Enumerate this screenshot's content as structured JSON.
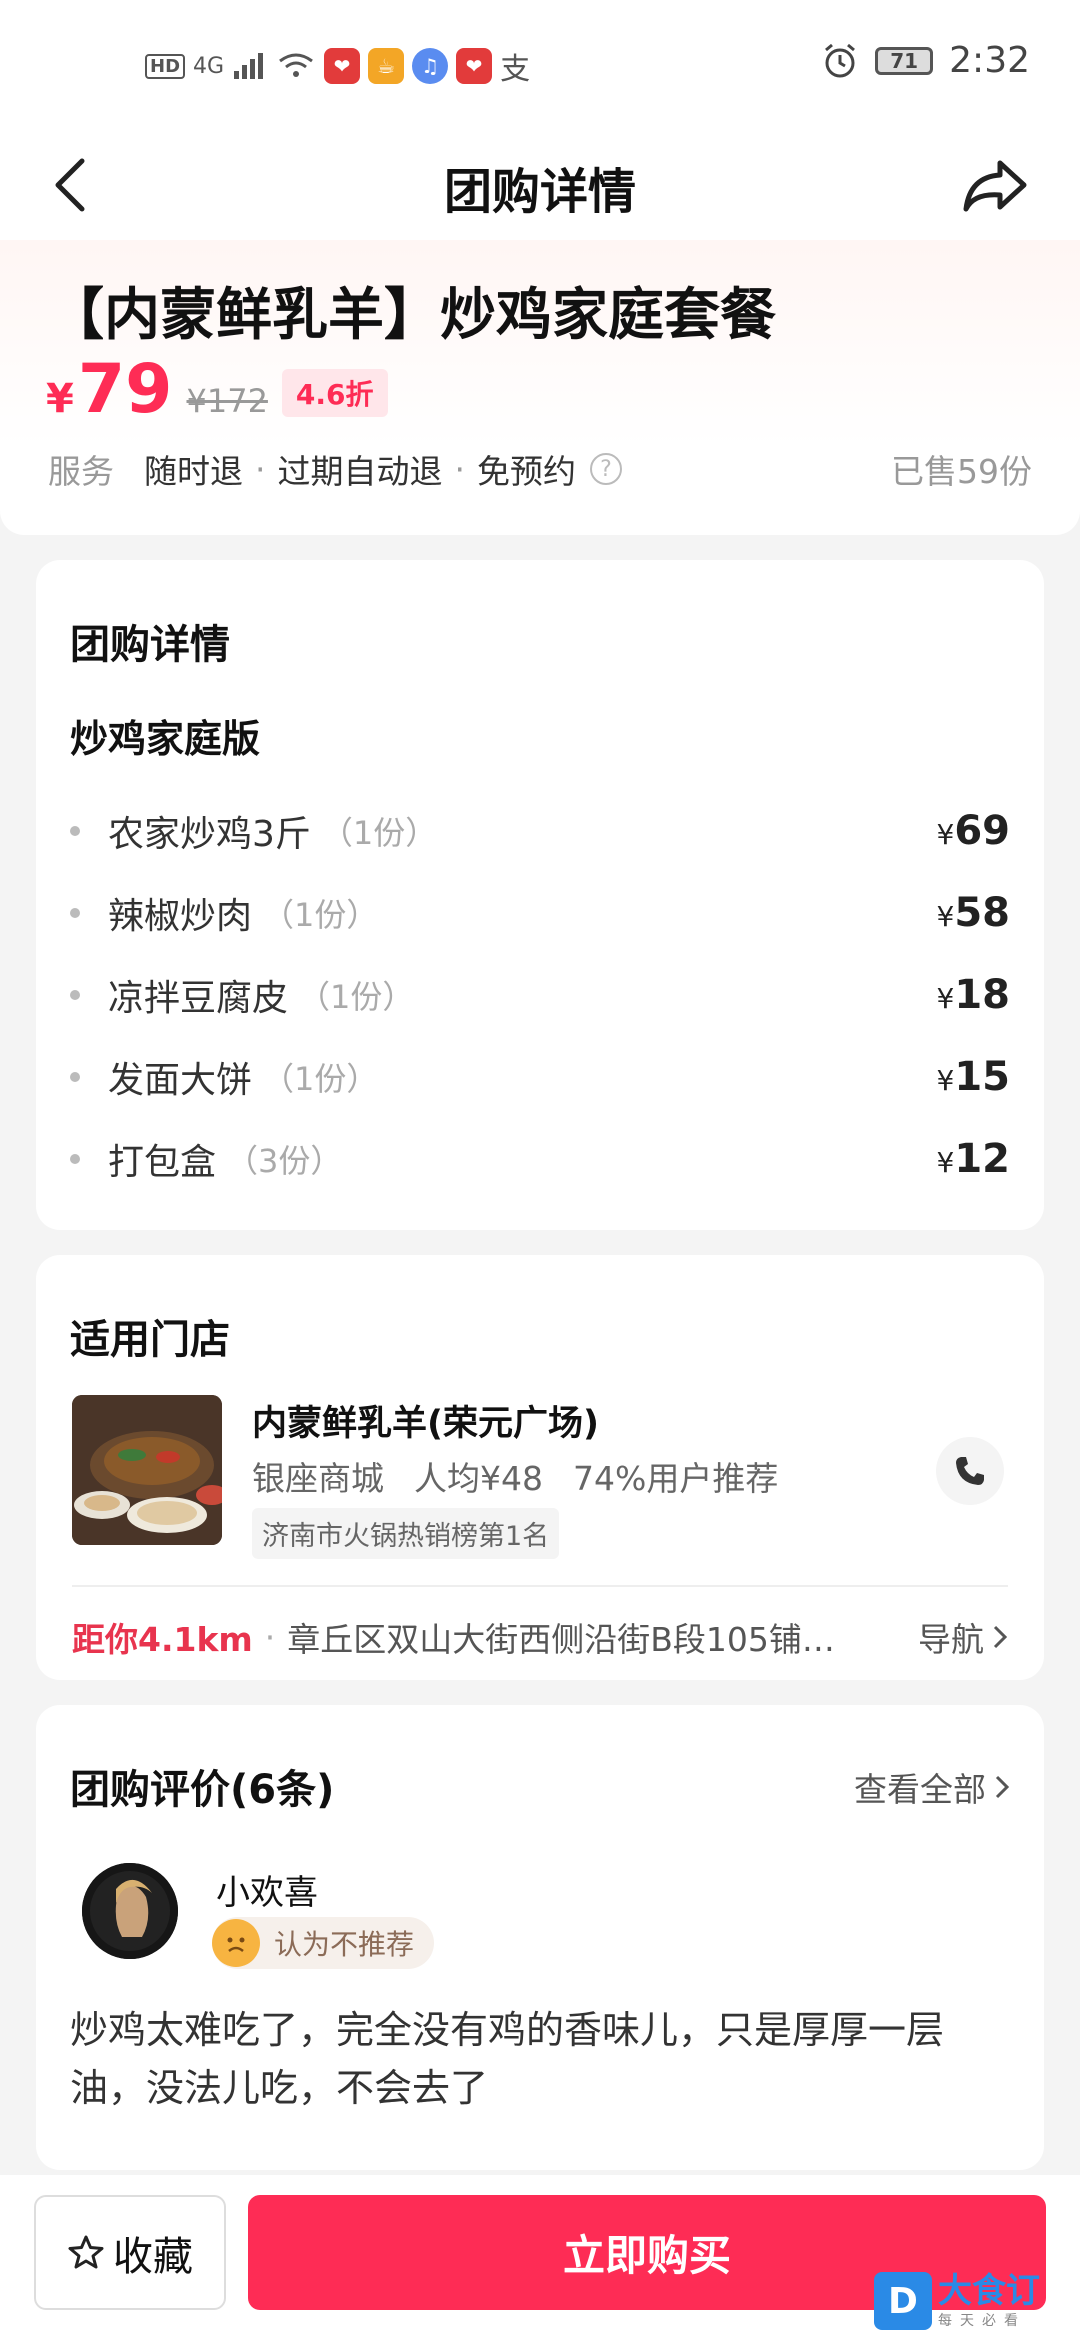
{
  "status_bar": {
    "left_badges": [
      "HD",
      "4G"
    ],
    "time": "2:32",
    "battery": "71"
  },
  "nav": {
    "title": "团购详情"
  },
  "deal": {
    "title": "【内蒙鲜乳羊】炒鸡家庭套餐",
    "currency": "¥",
    "price": "79",
    "original_price": "¥172",
    "discount": "4.6折",
    "service_label": "服务",
    "services": [
      "随时退",
      "过期自动退",
      "免预约"
    ],
    "sold": "已售59份"
  },
  "detail": {
    "title": "团购详情",
    "package_name": "炒鸡家庭版",
    "items": [
      {
        "name": "农家炒鸡3斤",
        "qty": "（1份）",
        "price": "69"
      },
      {
        "name": "辣椒炒肉",
        "qty": "（1份）",
        "price": "58"
      },
      {
        "name": "凉拌豆腐皮",
        "qty": "（1份）",
        "price": "18"
      },
      {
        "name": "发面大饼",
        "qty": "（1份）",
        "price": "15"
      },
      {
        "name": "打包盒",
        "qty": "（3份）",
        "price": "12"
      }
    ]
  },
  "store": {
    "title": "适用门店",
    "name": "内蒙鲜乳羊(荣元广场)",
    "mall": "银座商城",
    "per_capita": "人均¥48",
    "recommend": "74%用户推荐",
    "rank": "济南市火锅热销榜第1名",
    "distance": "距你4.1km",
    "address": "章丘区双山大街西侧沿街B段105铺…",
    "navigate": "导航"
  },
  "reviews": {
    "title": "团购评价(6条)",
    "view_all": "查看全部",
    "reviewer": "小欢喜",
    "recommend_tag": "认为不推荐",
    "text": "炒鸡太难吃了，完全没有鸡的香味儿，只是厚厚一层油，没法儿吃，不会去了"
  },
  "bottom": {
    "favorite": "收藏",
    "buy": "立即购买"
  },
  "watermark": {
    "brand": "大食订",
    "slogan": "每天必看"
  },
  "colors": {
    "accent": "#fe2c55",
    "distance": "#e8344e"
  }
}
